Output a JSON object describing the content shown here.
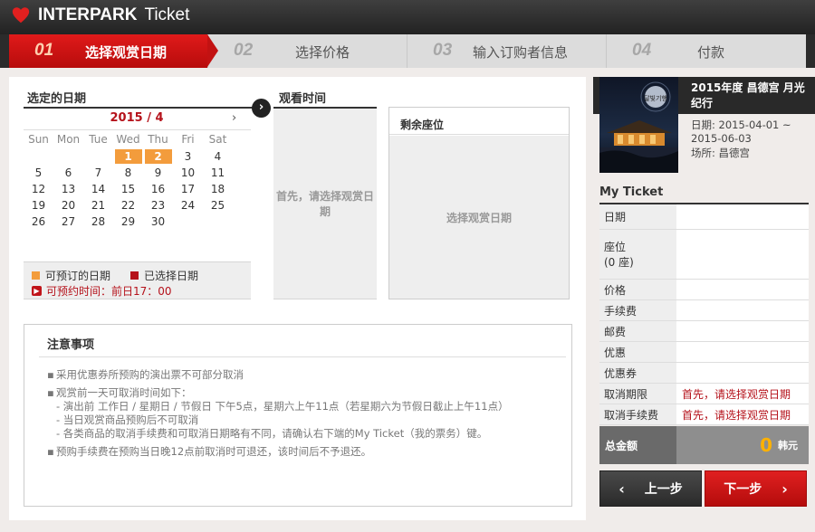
{
  "header": {
    "brand": "INTERPARK",
    "product": "Ticket"
  },
  "steps": [
    {
      "num": "01",
      "label": "选择观赏日期",
      "active": true
    },
    {
      "num": "02",
      "label": "选择价格"
    },
    {
      "num": "03",
      "label": "输入订购者信息"
    },
    {
      "num": "04",
      "label": "付款"
    }
  ],
  "date_section": {
    "title": "选定的日期"
  },
  "calendar": {
    "month_label": "2015 / 4",
    "weekdays": [
      "Sun",
      "Mon",
      "Tue",
      "Wed",
      "Thu",
      "Fri",
      "Sat"
    ],
    "weeks": [
      [
        "",
        "",
        "",
        "1",
        "2",
        "3",
        "4"
      ],
      [
        "5",
        "6",
        "7",
        "8",
        "9",
        "10",
        "11"
      ],
      [
        "12",
        "13",
        "14",
        "15",
        "16",
        "17",
        "18"
      ],
      [
        "19",
        "20",
        "21",
        "22",
        "23",
        "24",
        "25"
      ],
      [
        "26",
        "27",
        "28",
        "29",
        "30",
        "",
        ""
      ]
    ],
    "available_days": [
      "1",
      "2"
    ]
  },
  "legend": {
    "available": "可预订的日期",
    "selected": "已选择日期",
    "deadline": "可预约时间：前日17：00",
    "available_color": "#f39c3c",
    "selected_color": "#b5121b"
  },
  "time_section": {
    "title": "观看时间",
    "placeholder": "首先，请选择观赏日期"
  },
  "seat_section": {
    "title": "剩余座位",
    "placeholder": "选择观赏日期"
  },
  "notice": {
    "title": "注意事项",
    "items": [
      {
        "text": "采用优惠券所预购的演出票不可部分取消"
      },
      {
        "text": "观赏前一天可取消时间如下：",
        "sub": [
          "- 演出前 工作日 / 星期日 / 节假日 下午5点，星期六上午11点（若星期六为节假日截止上午11点）",
          "- 当日观赏商品预购后不可取消",
          "- 各类商品的取消手续费和可取消日期略有不同，请确认右下端的My Ticket（我的票务）键。"
        ]
      },
      {
        "text": "预购手续费在预购当日晚12点前取消时可退还，该时间后不予退还。"
      }
    ]
  },
  "show": {
    "title": "2015年度 昌德宫 月光纪行",
    "date": "日期: 2015-04-01 ~ 2015-06-03",
    "venue": "场所: 昌德宫",
    "poster_text": "달빛기행"
  },
  "my_ticket": {
    "title": "My Ticket",
    "rows": [
      {
        "label": "日期",
        "value": ""
      },
      {
        "label": "座位\n(0 座)",
        "value": ""
      },
      {
        "label": "价格",
        "value": ""
      },
      {
        "label": "手续费",
        "value": ""
      },
      {
        "label": "邮费",
        "value": ""
      },
      {
        "label": "优惠",
        "value": ""
      },
      {
        "label": "优惠券",
        "value": ""
      },
      {
        "label": "取消期限",
        "value": "首先，请选择观赏日期"
      },
      {
        "label": "取消手续费",
        "value": "首先，请选择观赏日期"
      }
    ],
    "total_label": "总金额",
    "total_value": "0",
    "total_unit": "韩元"
  },
  "buttons": {
    "prev": "上一步",
    "next": "下一步"
  },
  "colors": {
    "accent": "#c4141b",
    "available": "#f39c3c"
  }
}
